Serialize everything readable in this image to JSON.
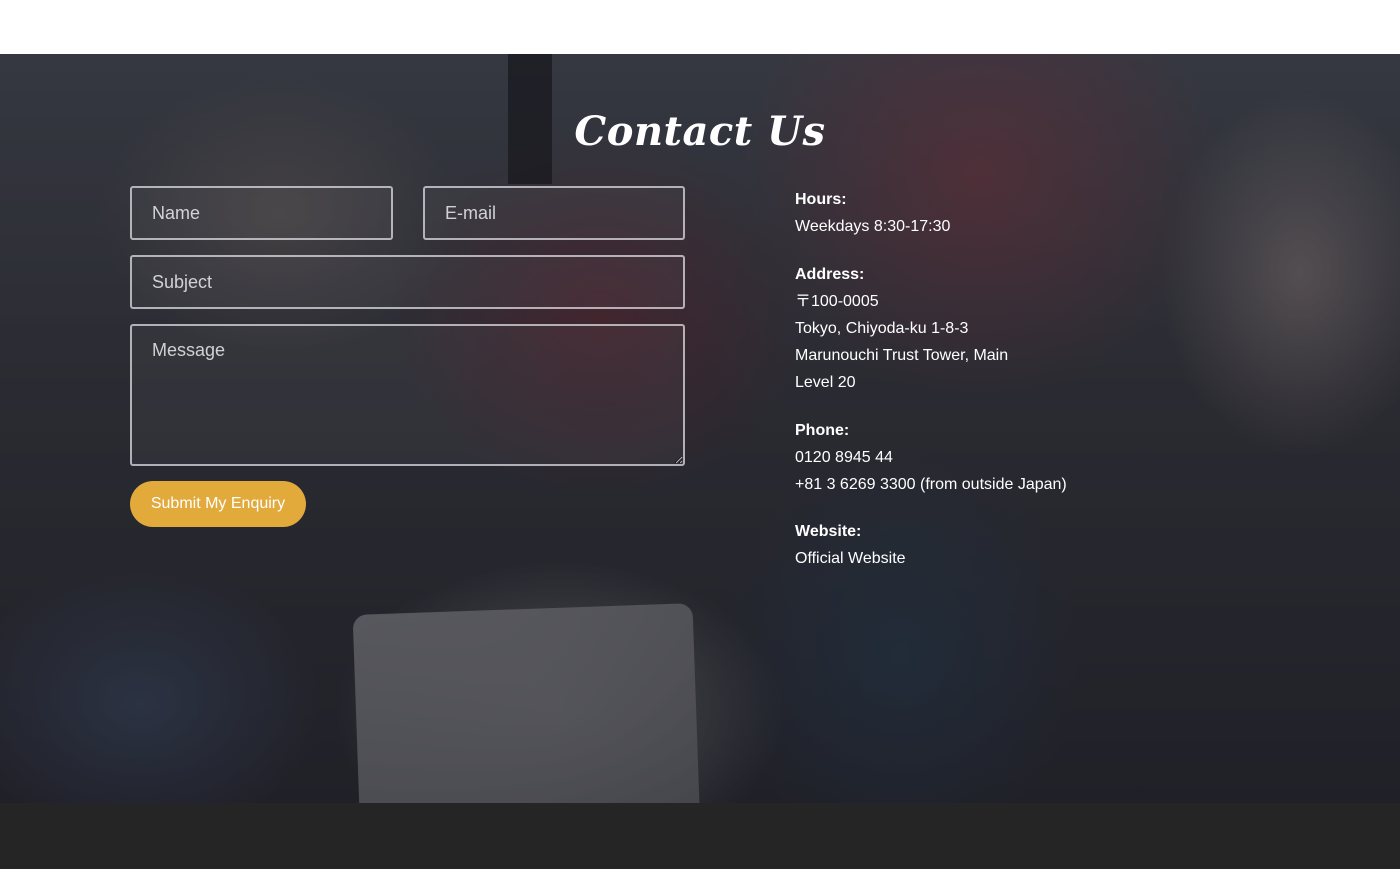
{
  "contact": {
    "title": "Contact Us",
    "form": {
      "name_placeholder": "Name",
      "email_placeholder": "E-mail",
      "subject_placeholder": "Subject",
      "message_placeholder": "Message",
      "submit_label": "Submit My Enquiry"
    },
    "info": {
      "hours_label": "Hours:",
      "hours_value": "Weekdays 8:30-17:30",
      "address_label": "Address:",
      "address_lines": [
        "〒100-0005",
        "Tokyo, Chiyoda-ku 1-8-3",
        "Marunouchi Trust Tower, Main",
        "Level 20"
      ],
      "phone_label": "Phone:",
      "phone_lines": [
        "0120 8945 44",
        "+81 3 6269 3300 (from outside Japan)"
      ],
      "website_label": "Website:",
      "website_link": "Official Website"
    }
  },
  "colors": {
    "accent": "#e2a93b",
    "footer": "#252525",
    "text": "#ffffff"
  }
}
